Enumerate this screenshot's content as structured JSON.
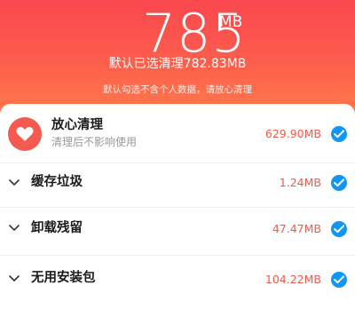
{
  "header": {
    "size_value": "785",
    "size_unit": "MB",
    "selected_text": "默认已选清理782.83MB",
    "hint_text": "默认勾选不含个人数据，请放心清理"
  },
  "items": [
    {
      "title": "放心清理",
      "subtitle": "清理后不影响使用",
      "size": "629.90MB",
      "icon": "heart-icon",
      "checked": true
    },
    {
      "title": "缓存垃圾",
      "size": "1.24MB",
      "icon": "chevron-down-icon",
      "checked": true
    },
    {
      "title": "卸载残留",
      "size": "47.47MB",
      "icon": "chevron-down-icon",
      "checked": true
    },
    {
      "title": "无用安装包",
      "size": "104.22MB",
      "icon": "chevron-down-icon",
      "checked": true
    }
  ],
  "colors": {
    "header_top": "#f9474f",
    "header_bottom": "#ff7a4a",
    "size_text": "#f2594b",
    "check_blue": "#1296f6"
  }
}
